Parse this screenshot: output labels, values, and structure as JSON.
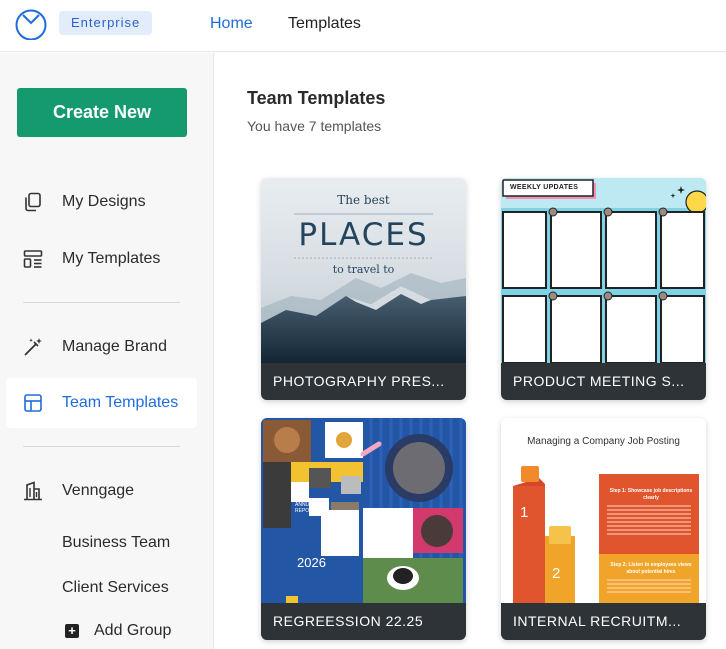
{
  "header": {
    "badge": "Enterprise",
    "nav": {
      "home": "Home",
      "templates": "Templates"
    }
  },
  "sidebar": {
    "create_label": "Create New",
    "items": [
      {
        "label": "My Designs",
        "icon": "copy-icon"
      },
      {
        "label": "My Templates",
        "icon": "templates-icon"
      },
      {
        "label": "Manage Brand",
        "icon": "magic-wand-icon"
      },
      {
        "label": "Team Templates",
        "icon": "table-icon"
      },
      {
        "label": "Venngage",
        "icon": "building-icon"
      }
    ],
    "sub_items": [
      "Business Team",
      "Client Services"
    ],
    "add_group_label": "Add Group"
  },
  "main": {
    "title": "Team Templates",
    "subtitle": "You have 7 templates"
  },
  "cards": [
    {
      "caption": "PHOTOGRAPHY PRES...",
      "thumb_line1": "The best",
      "thumb_line2": "PLACES",
      "thumb_line3": "to travel to"
    },
    {
      "caption": "PRODUCT MEETING S...",
      "thumb_heading": "WEEKLY UPDATES"
    },
    {
      "caption": "REGREESSION 22.25",
      "thumb_year": "2026",
      "thumb_annual": "ANNUAL REPORT"
    },
    {
      "caption": "INTERNAL RECRUITM...",
      "thumb_heading": "Managing a Company Job Posting",
      "step1": "Step 1: Showcase job descriptions clearly",
      "step2": "Step 2: Listen to employees views about potential hires",
      "num1": "1",
      "num2": "2"
    }
  ],
  "colors": {
    "accent": "#1e6ddb",
    "brand": "#149a6e",
    "caption_bg": "#2e3338",
    "badge_bg": "#e3ecfb"
  }
}
